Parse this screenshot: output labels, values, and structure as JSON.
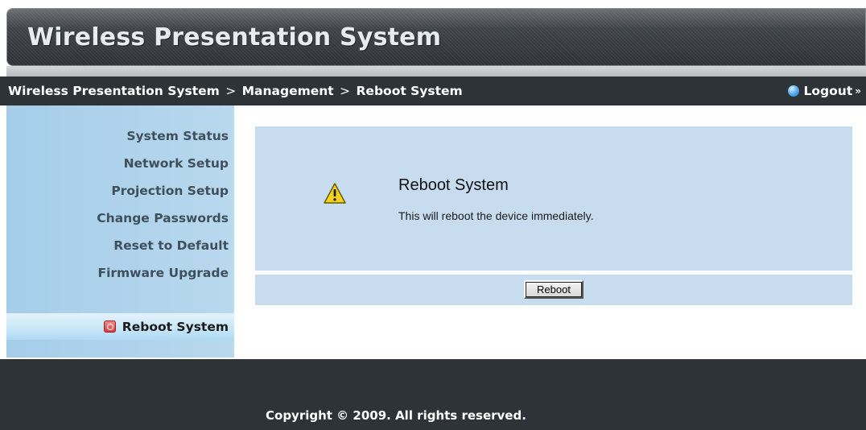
{
  "header": {
    "title": "Wireless Presentation System"
  },
  "breadcrumb": {
    "items": [
      "Wireless Presentation System",
      "Management",
      "Reboot System"
    ],
    "separator": ">"
  },
  "logout": {
    "label": "Logout",
    "arrow": "»",
    "icon": "globe-icon"
  },
  "sidebar": {
    "items": [
      {
        "label": "System Status"
      },
      {
        "label": "Network Setup"
      },
      {
        "label": "Projection Setup"
      },
      {
        "label": "Change Passwords"
      },
      {
        "label": "Reset to Default"
      },
      {
        "label": "Firmware Upgrade"
      }
    ],
    "active": {
      "label": "Reboot System",
      "icon": "power-icon"
    }
  },
  "main": {
    "title": "Reboot System",
    "description": "This will reboot the device immediately.",
    "warning_icon": "warning-icon",
    "button_label": "Reboot"
  },
  "footer": {
    "copyright": "Copyright © 2009. All rights reserved."
  },
  "colors": {
    "bar_dark": "#2e3338",
    "sidebar_blue": "#a5cde9",
    "panel_blue": "#c8dcef",
    "warning_yellow": "#f3d21a"
  }
}
